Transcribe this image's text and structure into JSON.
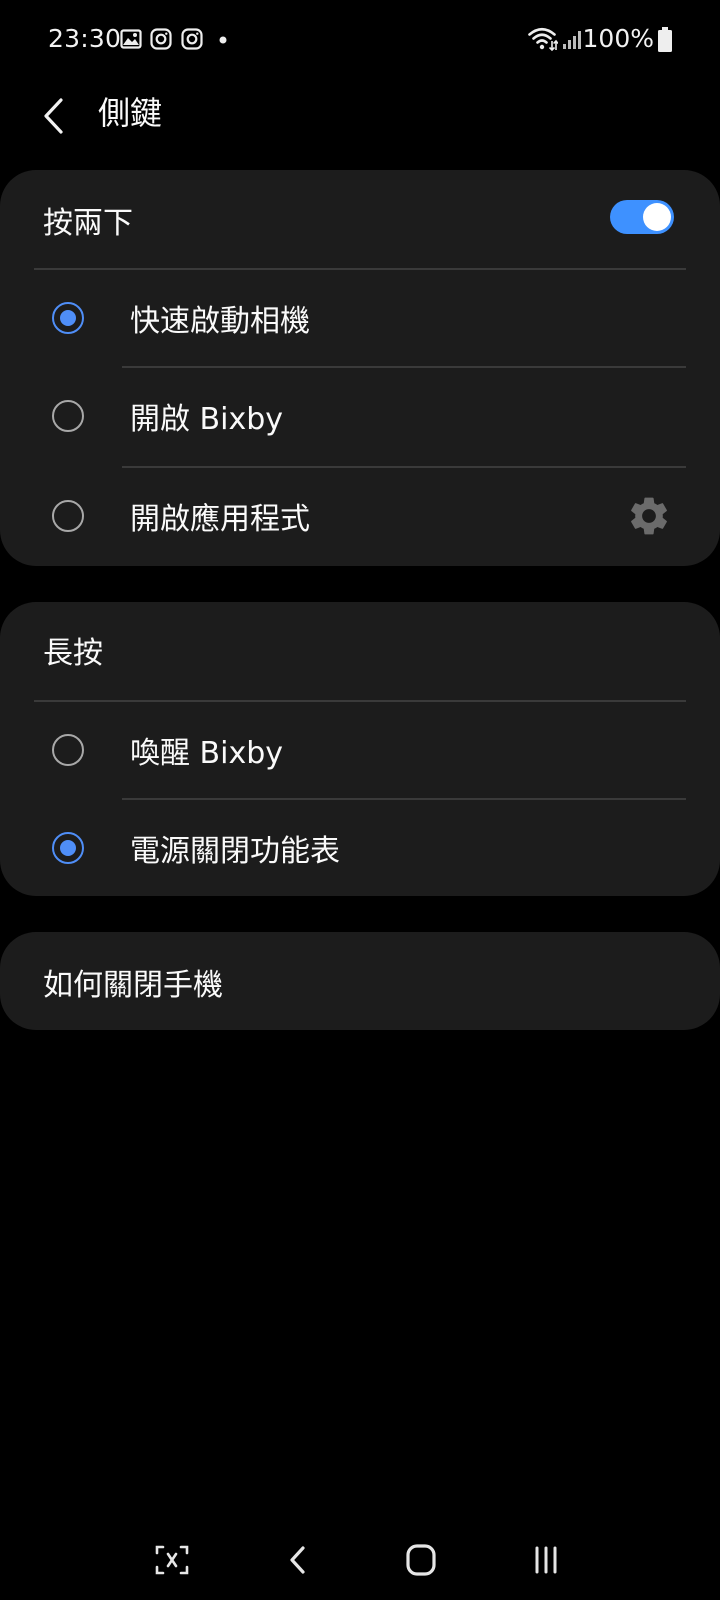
{
  "status_bar": {
    "time": "23:30",
    "left_icons": [
      "gallery-icon",
      "instagram-icon",
      "instagram-icon",
      "notification-dot-icon"
    ],
    "right_icons": [
      "wifi-icon",
      "signal-icon",
      "battery-icon"
    ],
    "battery_text": "100%"
  },
  "header": {
    "title": "側鍵"
  },
  "double_press": {
    "title": "按兩下",
    "toggle_on": true,
    "options": [
      {
        "label": "快速啟動相機",
        "selected": true
      },
      {
        "label": "開啟 Bixby",
        "selected": false
      },
      {
        "label": "開啟應用程式",
        "selected": false,
        "has_settings_icon": true
      }
    ]
  },
  "long_press": {
    "title": "長按",
    "options": [
      {
        "label": "喚醒 Bixby",
        "selected": false
      },
      {
        "label": "電源關閉功能表",
        "selected": true
      }
    ]
  },
  "how_to_power_off": {
    "label": "如何關閉手機"
  },
  "nav_bar": {
    "buttons": [
      "screenshot-capture-icon",
      "back-icon",
      "home-icon",
      "recents-icon"
    ]
  },
  "colors": {
    "background": "#000000",
    "card": "#1c1c1c",
    "accent": "#4f8ef7",
    "toggle": "#3e91ff",
    "divider": "#3a3a3a"
  }
}
